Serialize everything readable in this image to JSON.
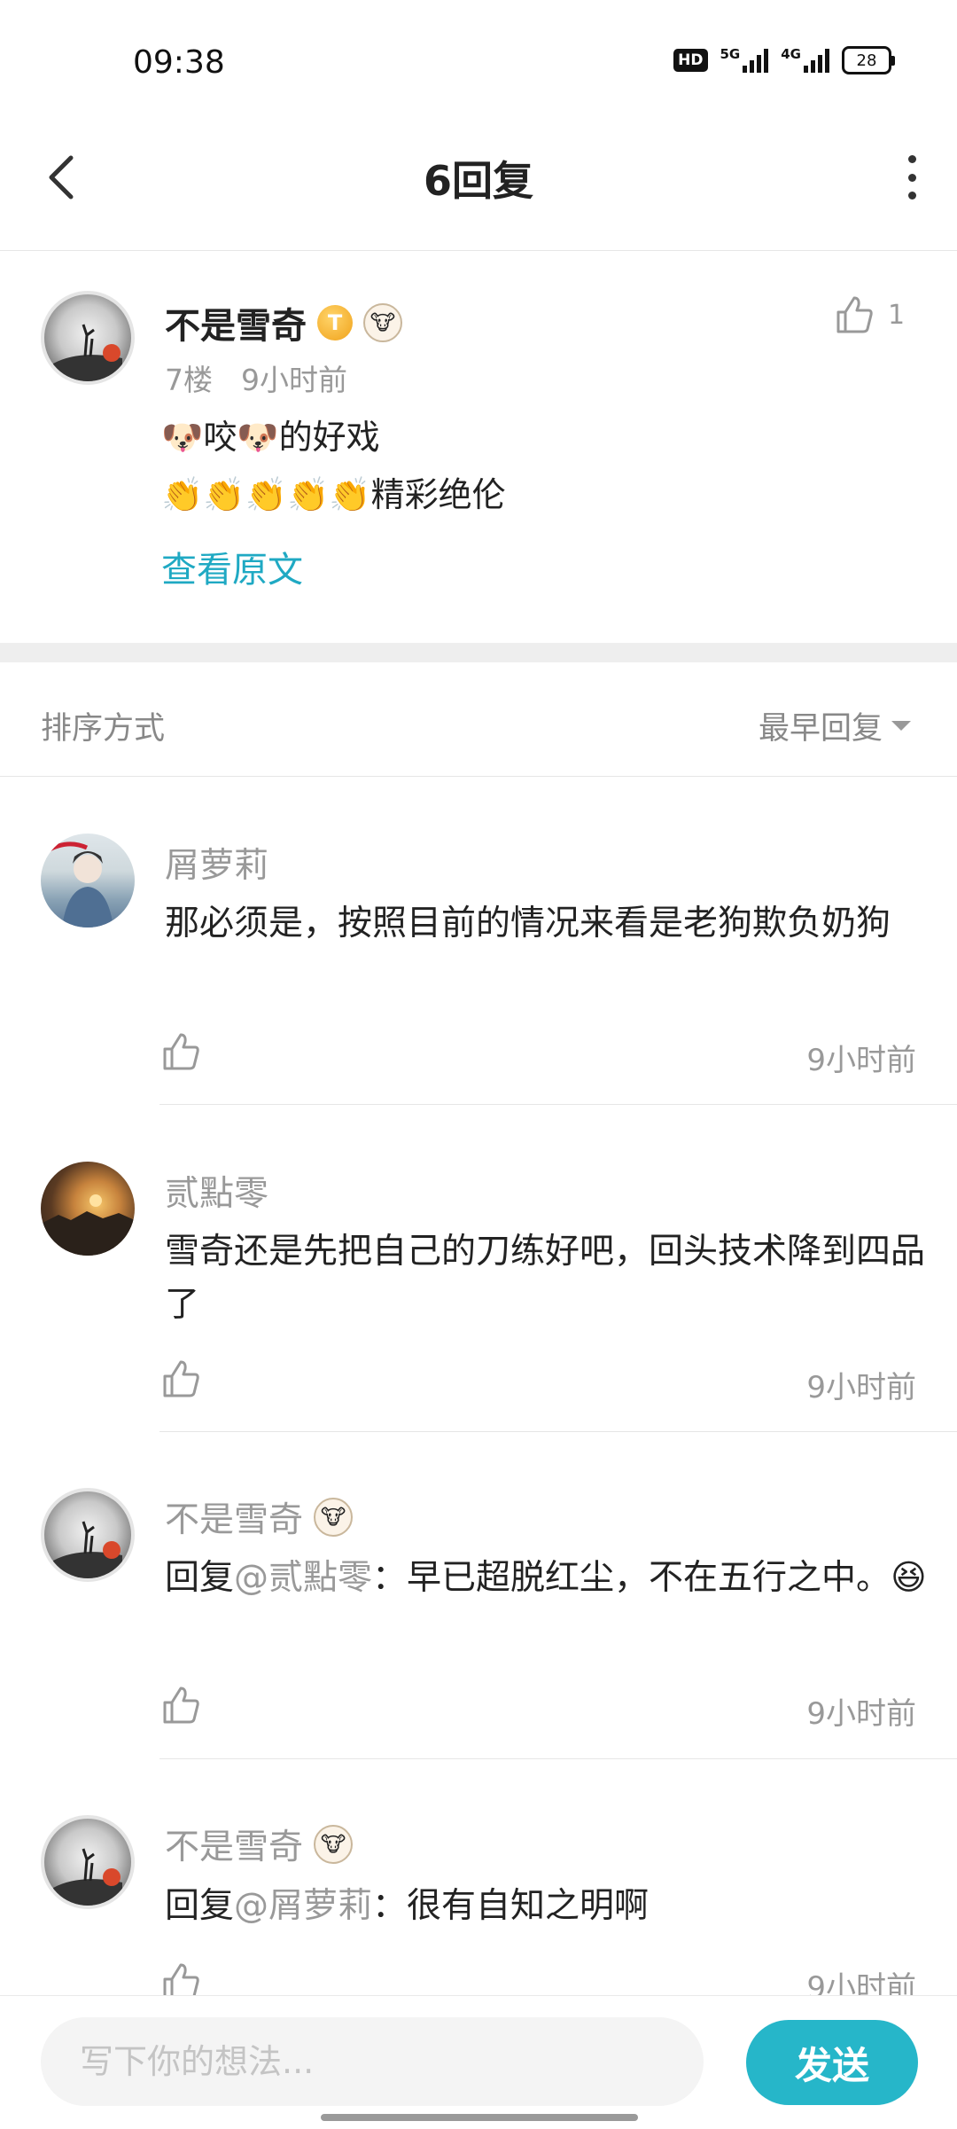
{
  "status_bar": {
    "time": "09:38",
    "hd_label": "HD",
    "net_5g": "5G",
    "net_4g": "4G",
    "battery": "28"
  },
  "header": {
    "title": "6回复"
  },
  "original_post": {
    "author": "不是雪奇",
    "badge_letter": "T",
    "floor": "7楼",
    "time": "9小时前",
    "line1": "🐶咬🐶的好戏",
    "line2": "👏👏👏👏👏精彩绝伦",
    "like_count": "1",
    "view_original": "查看原文"
  },
  "sort": {
    "label": "排序方式",
    "value": "最早回复"
  },
  "replies": [
    {
      "author": "屑萝莉",
      "text": "那必须是，按照目前的情况来看是老狗欺负奶狗",
      "time": "9小时前"
    },
    {
      "author": "贰點零",
      "text": "雪奇还是先把自己的刀练好吧，回头技术降到四品了",
      "time": "9小时前"
    },
    {
      "author": "不是雪奇",
      "reply_prefix": "回复",
      "mention": "@贰點零",
      "text": "：早已超脱红尘，不在五行之中。😆",
      "time": "9小时前"
    },
    {
      "author": "不是雪奇",
      "reply_prefix": "回复",
      "mention": "@屑萝莉",
      "text": "：很有自知之明啊",
      "time": "9小时前"
    }
  ],
  "composer": {
    "placeholder": "写下你的想法...",
    "send_label": "发送"
  },
  "colors": {
    "accent": "#26b6c9",
    "link": "#1fa9c3"
  }
}
